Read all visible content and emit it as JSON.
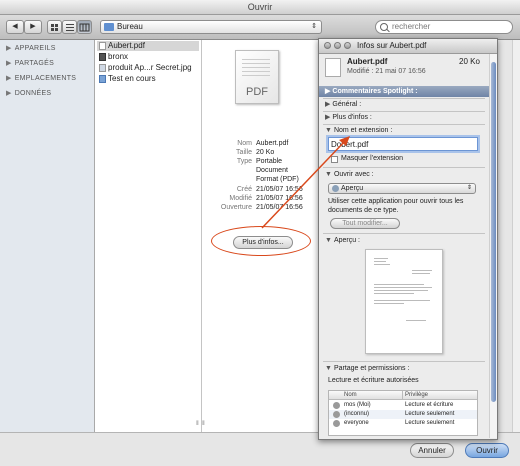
{
  "window": {
    "title": "Ouvrir"
  },
  "toolbar": {
    "nav_back": "◀",
    "nav_forward": "▶",
    "location": "Bureau",
    "search_placeholder": "rechercher"
  },
  "sidebar": {
    "sections": [
      {
        "label": "APPAREILS"
      },
      {
        "label": "PARTAGÉS"
      },
      {
        "label": "EMPLACEMENTS"
      },
      {
        "label": "DONNÉES"
      }
    ]
  },
  "files": [
    {
      "name": "Aubert.pdf",
      "kind": "pdf",
      "selected": true
    },
    {
      "name": "bronx",
      "kind": "app",
      "selected": false
    },
    {
      "name": "produit Ap...r Secret.jpg",
      "kind": "image",
      "selected": false
    },
    {
      "name": "Test en cours",
      "kind": "folder",
      "selected": false
    }
  ],
  "preview": {
    "icon_label": "PDF",
    "meta": [
      {
        "label": "Nom",
        "value": "Aubert.pdf"
      },
      {
        "label": "Taille",
        "value": "20 Ko"
      },
      {
        "label": "Type",
        "value": "Portable"
      },
      {
        "label": "",
        "value": "Document"
      },
      {
        "label": "",
        "value": "Format (PDF)"
      },
      {
        "label": "Créé",
        "value": "21/05/07 16:56"
      },
      {
        "label": "Modifié",
        "value": "21/05/07 16:56"
      },
      {
        "label": "Ouverture",
        "value": "21/05/07 16:56"
      }
    ],
    "more_info_button": "Plus d'infos..."
  },
  "buttons": {
    "cancel": "Annuler",
    "open": "Ouvrir"
  },
  "info_panel": {
    "title": "Infos sur Aubert.pdf",
    "filename": "Aubert.pdf",
    "size": "20 Ko",
    "modified": "Modifié : 21 mai 07 16:56",
    "sections": {
      "spotlight": "Commentaires Spotlight :",
      "general": "Général :",
      "more_info": "Plus d'infos :",
      "name_ext": "Nom et extension :",
      "open_with": "Ouvrir avec :",
      "preview": "Aperçu :",
      "sharing": "Partage et permissions :"
    },
    "name_value": "Dobert.pdf",
    "hide_extension": "Masquer l'extension",
    "app": "Aperçu",
    "open_with_help": "Utiliser cette application pour ouvrir tous les documents de ce type.",
    "change_all": "Tout modifier...",
    "rw_text": "Lecture et écriture autorisées",
    "perm_headers": {
      "name": "Nom",
      "privilege": "Privilège"
    },
    "permissions": [
      {
        "user": "mos (Moi)",
        "privilege": "Lecture et écriture"
      },
      {
        "user": "(inconnu)",
        "privilege": "Lecture seulement"
      },
      {
        "user": "everyone",
        "privilege": "Lecture seulement"
      }
    ]
  },
  "colors": {
    "annotation": "#d9491c",
    "selection": "#6c95d4"
  }
}
